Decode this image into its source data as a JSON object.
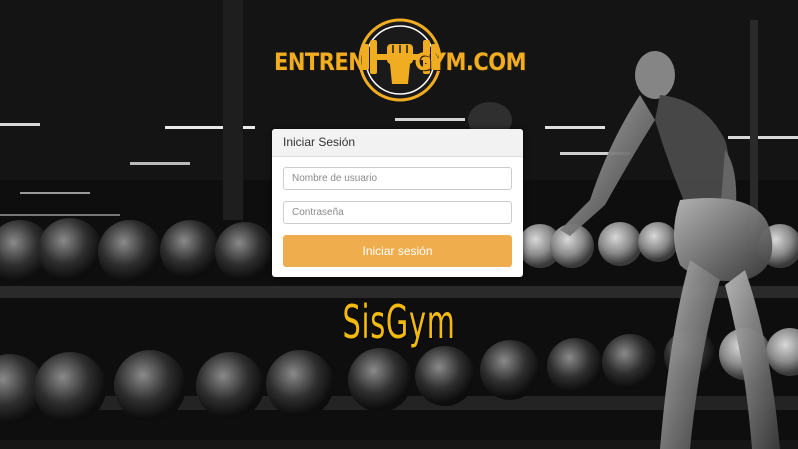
{
  "logo": {
    "left_text": "ENTRENA",
    "right_text": "GYM.COM",
    "emblem": "dumbbell-fist-icon"
  },
  "login": {
    "heading": "Iniciar Sesión",
    "username_placeholder": "Nombre de usuario",
    "username_value": "",
    "password_placeholder": "Contraseña",
    "password_value": "",
    "submit_label": "Iniciar sesión"
  },
  "brand": {
    "name": "SisGym"
  },
  "colors": {
    "accent": "#f0ad4e",
    "brand_text": "#f2b90f",
    "logo": "#f0ad22",
    "panel_heading_bg": "#f2f2f2"
  }
}
